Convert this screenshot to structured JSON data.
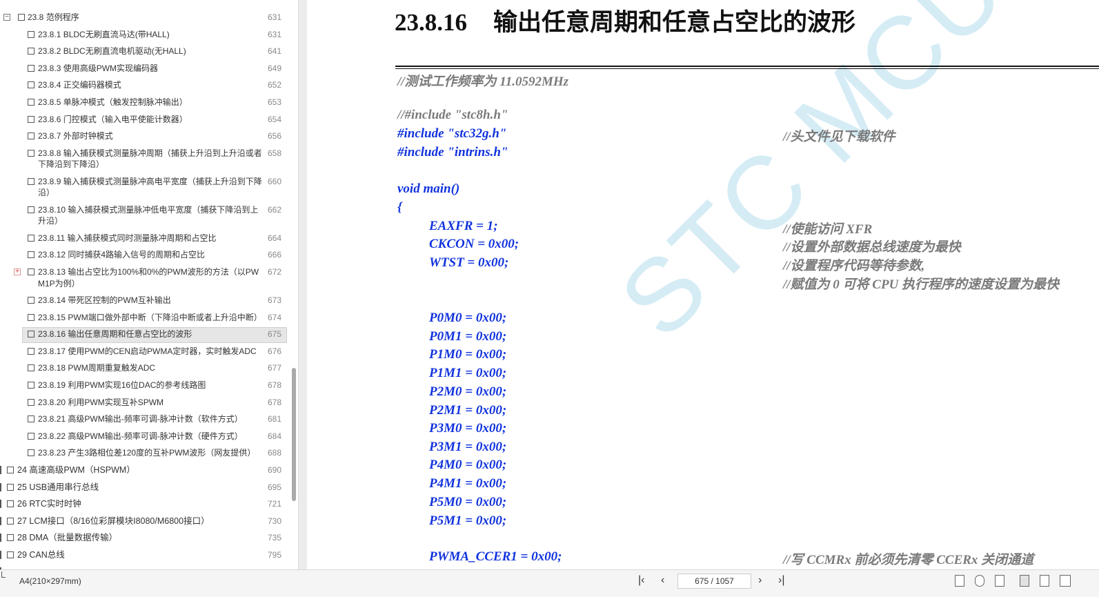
{
  "sidebar": {
    "items": [
      {
        "label": "23.8 范例程序",
        "page": "631",
        "level": 1,
        "expanded": true
      },
      {
        "label": "23.8.1 BLDC无刷直流马达(带HALL)",
        "page": "631",
        "level": 2
      },
      {
        "label": "23.8.2 BLDC无刷直流电机驱动(无HALL)",
        "page": "641",
        "level": 2
      },
      {
        "label": "23.8.3 使用高级PWM实现编码器",
        "page": "649",
        "level": 2
      },
      {
        "label": "23.8.4 正交编码器模式",
        "page": "652",
        "level": 2
      },
      {
        "label": "23.8.5 单脉冲模式（触发控制脉冲输出）",
        "page": "653",
        "level": 2
      },
      {
        "label": "23.8.6 门控模式（输入电平使能计数器）",
        "page": "654",
        "level": 2
      },
      {
        "label": "23.8.7 外部时钟模式",
        "page": "656",
        "level": 2
      },
      {
        "label": "23.8.8 输入捕获模式测量脉冲周期（捕获上升沿到上升沿或者",
        "label2": "下降沿到下降沿）",
        "page": "658",
        "level": 2
      },
      {
        "label": "23.8.9 输入捕获模式测量脉冲高电平宽度（捕获上升沿到下降",
        "label2": "沿）",
        "page": "660",
        "level": 2
      },
      {
        "label": "23.8.10 输入捕获模式测量脉冲低电平宽度（捕获下降沿到上",
        "label2": "升沿）",
        "page": "662",
        "level": 2
      },
      {
        "label": "23.8.11 输入捕获模式同时测量脉冲周期和占空比",
        "page": "664",
        "level": 2
      },
      {
        "label": "23.8.12 同时捕获4路输入信号的周期和占空比",
        "page": "666",
        "level": 2
      },
      {
        "label": "23.8.13 输出占空比为100%和0%的PWM波形的方法（以PW",
        "label2": "M1P为例）",
        "page": "672",
        "level": 2,
        "collapsed": true
      },
      {
        "label": "23.8.14 带死区控制的PWM互补输出",
        "page": "673",
        "level": 2
      },
      {
        "label": "23.8.15 PWM端口做外部中断（下降沿中断或者上升沿中断）",
        "page": "674",
        "level": 2
      },
      {
        "label": "23.8.16 输出任意周期和任意占空比的波形",
        "page": "675",
        "level": 2,
        "selected": true
      },
      {
        "label": "23.8.17 使用PWM的CEN启动PWMA定时器，实时触发ADC",
        "page": "676",
        "level": 2
      },
      {
        "label": "23.8.18 PWM周期重复触发ADC",
        "page": "677",
        "level": 2
      },
      {
        "label": "23.8.19 利用PWM实现16位DAC的参考线路图",
        "page": "678",
        "level": 2
      },
      {
        "label": "23.8.20 利用PWM实现互补SPWM",
        "page": "678",
        "level": 2
      },
      {
        "label": "23.8.21 高级PWM输出-频率可调-脉冲计数（软件方式）",
        "page": "681",
        "level": 2
      },
      {
        "label": "23.8.22 高级PWM输出-频率可调-脉冲计数（硬件方式）",
        "page": "684",
        "level": 2
      },
      {
        "label": "23.8.23 产生3路相位差120度的互补PWM波形（网友提供）",
        "page": "688",
        "level": 2
      },
      {
        "label": "24 高速高级PWM（HSPWM）",
        "page": "690",
        "level": 0
      },
      {
        "label": "25 USB通用串行总线",
        "page": "695",
        "level": 0
      },
      {
        "label": "26 RTC实时时钟",
        "page": "721",
        "level": 0
      },
      {
        "label": "27 LCM接口（8/16位彩屏模块I8080/M6800接口）",
        "page": "730",
        "level": 0
      },
      {
        "label": "28 DMA（批量数据传输）",
        "page": "735",
        "level": 0
      },
      {
        "label": "29 CAN总线",
        "page": "795",
        "level": 0
      }
    ]
  },
  "document": {
    "title_number": "23.8.16",
    "title_text": "输出任意周期和任意占空比的波形",
    "watermark": "STC MCU",
    "code_lines": [
      {
        "text": "//测试工作频率为 11.0592MHz",
        "kind": "cmt",
        "indent": 0
      },
      {
        "text": "//#include \"stc8h.h\"",
        "kind": "cmt",
        "indent": 0
      },
      {
        "text": "#include \"stc32g.h\"",
        "kind": "code",
        "indent": 0,
        "comment": "//头文件见下载软件"
      },
      {
        "text": "#include \"intrins.h\"",
        "kind": "code",
        "indent": 0
      },
      {
        "text": "void main()",
        "kind": "code",
        "indent": 0
      },
      {
        "text": "{",
        "kind": "code",
        "indent": 0
      },
      {
        "text": "EAXFR = 1;",
        "kind": "code",
        "indent": 1,
        "comment": "//使能访问 XFR"
      },
      {
        "text": "CKCON = 0x00;",
        "kind": "code",
        "indent": 1,
        "comment": "//设置外部数据总线速度为最快"
      },
      {
        "text": "WTST = 0x00;",
        "kind": "code",
        "indent": 1,
        "comment": "//设置程序代码等待参数,"
      },
      {
        "text": "",
        "kind": "code",
        "indent": 1,
        "comment": "//赋值为 0 可将 CPU 执行程序的速度设置为最快"
      },
      {
        "text": "P0M0 = 0x00;",
        "kind": "code",
        "indent": 1
      },
      {
        "text": "P0M1 = 0x00;",
        "kind": "code",
        "indent": 1
      },
      {
        "text": "P1M0 = 0x00;",
        "kind": "code",
        "indent": 1
      },
      {
        "text": "P1M1 = 0x00;",
        "kind": "code",
        "indent": 1
      },
      {
        "text": "P2M0 = 0x00;",
        "kind": "code",
        "indent": 1
      },
      {
        "text": "P2M1 = 0x00;",
        "kind": "code",
        "indent": 1
      },
      {
        "text": "P3M0 = 0x00;",
        "kind": "code",
        "indent": 1
      },
      {
        "text": "P3M1 = 0x00;",
        "kind": "code",
        "indent": 1
      },
      {
        "text": "P4M0 = 0x00;",
        "kind": "code",
        "indent": 1
      },
      {
        "text": "P4M1 = 0x00;",
        "kind": "code",
        "indent": 1
      },
      {
        "text": "P5M0 = 0x00;",
        "kind": "code",
        "indent": 1
      },
      {
        "text": "P5M1 = 0x00;",
        "kind": "code",
        "indent": 1
      },
      {
        "text": "PWMA_CCER1 = 0x00;",
        "kind": "code",
        "indent": 1,
        "comment": "//写 CCMRx 前必须先清零 CCERx 关闭通道"
      }
    ]
  },
  "statusbar": {
    "paper_size": "A4(210×297mm)",
    "page_indicator": "675 / 1057",
    "icons": [
      "first-page-icon",
      "prev-page-icon",
      "next-page-icon",
      "last-page-icon"
    ]
  },
  "colors": {
    "code": "#1133dd",
    "comment": "#7a7a7a",
    "watermark": "#5bb8d8",
    "selected_bg": "#e6e6e6"
  }
}
